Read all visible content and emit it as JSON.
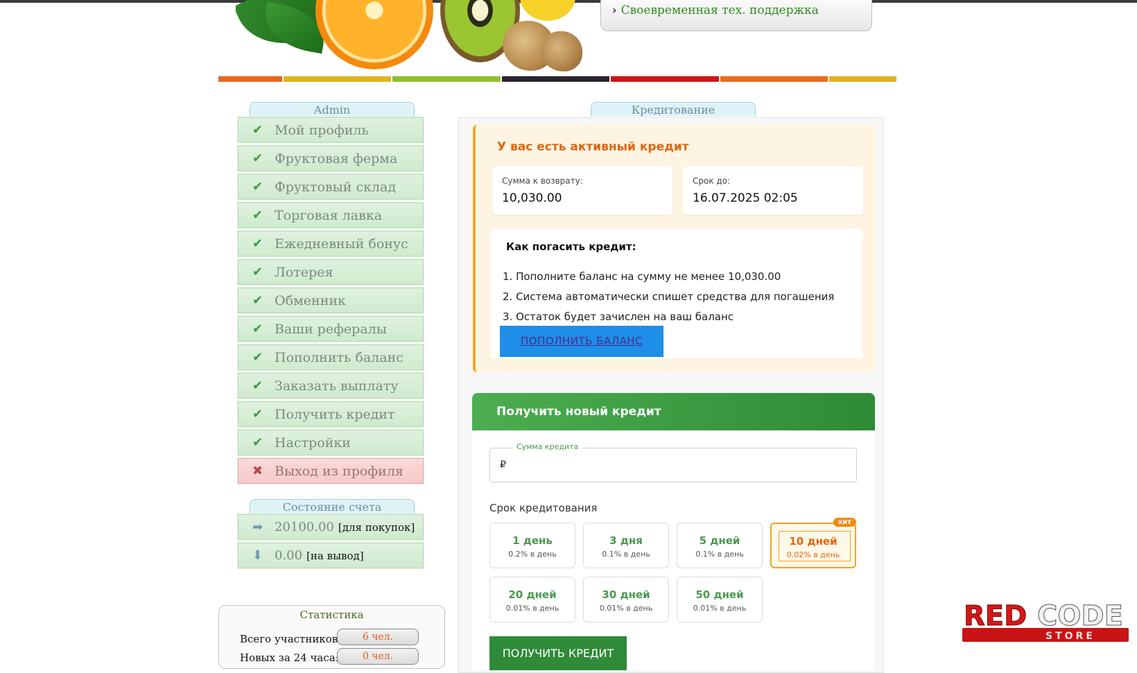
{
  "header": {
    "support_text": "Своевременная тех. поддержка",
    "colorbar": [
      "#e8661f",
      "#e0b41f",
      "#8fbf2a",
      "#2b2430",
      "#d01515",
      "#ea6a1d",
      "#e2b024"
    ]
  },
  "sidebar": {
    "tab_title": "Admin",
    "items": [
      {
        "label": "Мой профиль"
      },
      {
        "label": "Фруктовая ферма"
      },
      {
        "label": "Фруктовый склад"
      },
      {
        "label": "Торговая лавка"
      },
      {
        "label": "Ежедневный бонус"
      },
      {
        "label": "Лотерея"
      },
      {
        "label": "Обменник"
      },
      {
        "label": "Ваши рефералы"
      },
      {
        "label": "Пополнить баланс"
      },
      {
        "label": "Заказать выплату"
      },
      {
        "label": "Получить кредит"
      },
      {
        "label": "Настройки"
      }
    ],
    "logout_label": "Выход из профиля"
  },
  "account": {
    "tab_title": "Состояние счета",
    "buy_value": "20100.00",
    "buy_label": "[для покупок]",
    "withdraw_value": "0.00",
    "withdraw_label": "[на вывод]"
  },
  "stats": {
    "title": "Статистика",
    "total_label": "Всего участников:",
    "total_value": "6 чел.",
    "new_label": "Новых за 24 часа:",
    "new_value": "0 чел."
  },
  "content": {
    "tab_title": "Кредитование",
    "active": {
      "title": "У вас есть активный кредит",
      "amount_label": "Сумма к возврату:",
      "amount_value": "10,030.00",
      "due_label": "Срок до:",
      "due_value": "16.07.2025 02:05",
      "howto_title": "Как погасить кредит:",
      "steps": [
        "1. Пополните баланс на сумму не менее 10,030.00",
        "2. Система автоматически спишет средства для погашения",
        "3. Остаток будет зачислен на ваш баланс"
      ],
      "topup_button": "ПОПОЛНИТЬ БАЛАНС"
    },
    "new_credit": {
      "title": "Получить новый кредит",
      "amount_label": "Сумма кредита",
      "currency": "₽",
      "term_label": "Срок кредитования",
      "terms": [
        {
          "days": "1 день",
          "rate": "0.2% в день"
        },
        {
          "days": "3 дня",
          "rate": "0.1% в день"
        },
        {
          "days": "5 дней",
          "rate": "0.1% в день"
        },
        {
          "days": "10 дней",
          "rate": "0.02% в день",
          "badge": "хит"
        },
        {
          "days": "20 дней",
          "rate": "0.01% в день"
        },
        {
          "days": "30 дней",
          "rate": "0.01% в день"
        },
        {
          "days": "50 дней",
          "rate": "0.01% в день"
        }
      ],
      "submit_button": "ПОЛУЧИТЬ КРЕДИТ"
    }
  },
  "watermark": {
    "top": "RED",
    "top2": "CODE",
    "bottom": "STORE"
  }
}
